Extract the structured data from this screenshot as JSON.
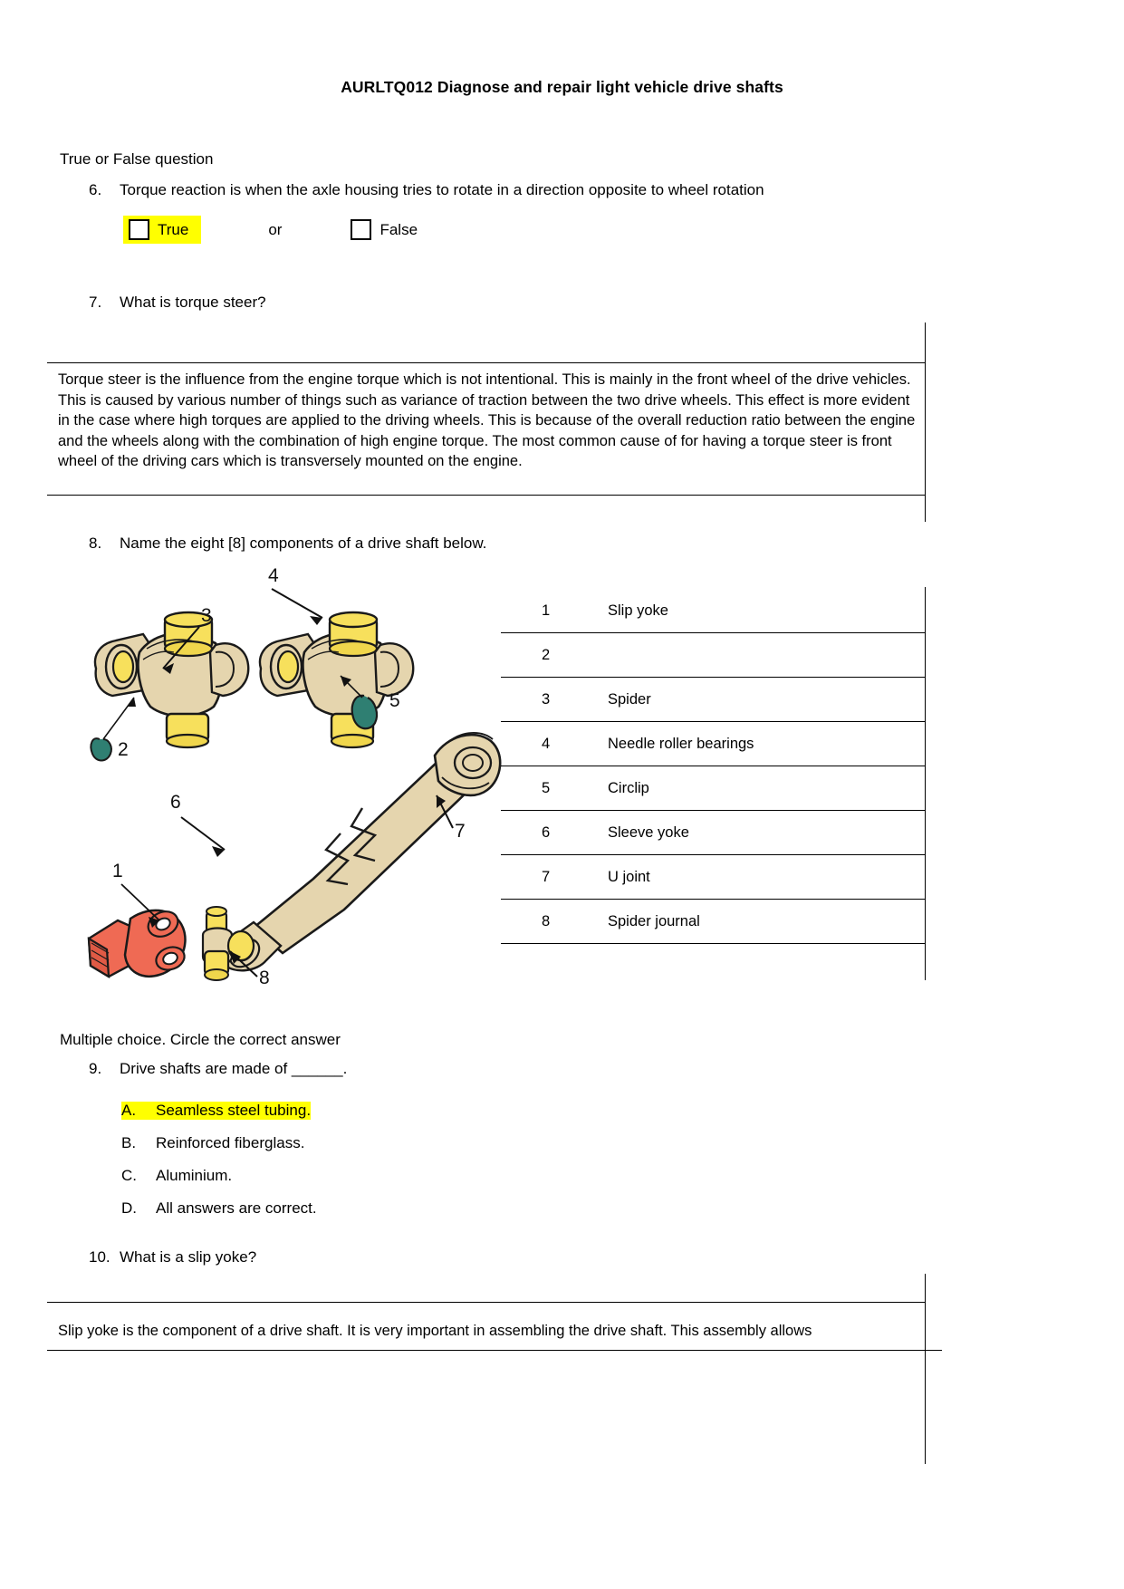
{
  "document": {
    "title": "AURLTQ012 Diagnose and repair light vehicle drive shafts"
  },
  "sections": {
    "true_false_label": "True or False question",
    "multiple_choice_label": "Multiple choice. Circle the correct answer"
  },
  "questions": {
    "q6": {
      "number": "6.",
      "text": "Torque reaction is when the axle housing tries to rotate in a direction opposite to wheel rotation",
      "option_true": "True",
      "option_or": "or",
      "option_false": "False",
      "selected": "True",
      "highlight_color": "#ffff00"
    },
    "q7": {
      "number": "7.",
      "text": "What is torque steer?",
      "answer": "Torque steer is the influence from the engine torque which is not intentional. This is mainly in the front wheel of the drive vehicles. This is caused by various number of things such as variance of traction between the two drive wheels. This effect is more evident in the case where high torques are applied to the driving wheels. This is because of the overall reduction ratio between the engine and the wheels along with the combination of high engine torque. The most common cause of for having a torque steer is front wheel of the driving cars which is transversely mounted on the engine."
    },
    "q8": {
      "number": "8.",
      "text": "Name the eight [8] components of a drive shaft below.",
      "components": [
        {
          "index": "1",
          "name": "Slip yoke"
        },
        {
          "index": "2",
          "name": ""
        },
        {
          "index": "3",
          "name": "Spider"
        },
        {
          "index": "4",
          "name": "Needle roller bearings"
        },
        {
          "index": "5",
          "name": "Circlip"
        },
        {
          "index": "6",
          "name": "Sleeve yoke"
        },
        {
          "index": "7",
          "name": "U joint"
        },
        {
          "index": "8",
          "name": "Spider journal"
        }
      ],
      "diagram_callouts": [
        "1",
        "2",
        "3",
        "4",
        "5",
        "6",
        "7",
        "8"
      ],
      "diagram_colors": {
        "body": "#e5d5ae",
        "yellow": "#f7e05c",
        "teal": "#2f7f72",
        "red": "#ef6a54",
        "outline": "#1a1a1a"
      }
    },
    "q9": {
      "number": "9.",
      "text": "Drive shafts are made of ______.",
      "options": [
        {
          "letter": "A.",
          "text": "Seamless steel tubing.",
          "highlighted": true
        },
        {
          "letter": "B.",
          "text": "Reinforced fiberglass.",
          "highlighted": false
        },
        {
          "letter": "C.",
          "text": "Aluminium.",
          "highlighted": false
        },
        {
          "letter": "D.",
          "text": "All answers are correct.",
          "highlighted": false
        }
      ]
    },
    "q10": {
      "number": "10.",
      "text": "What is a slip yoke?",
      "answer": "Slip yoke is the component of a drive shaft. It is very important in assembling the drive shaft. This assembly allows"
    }
  }
}
